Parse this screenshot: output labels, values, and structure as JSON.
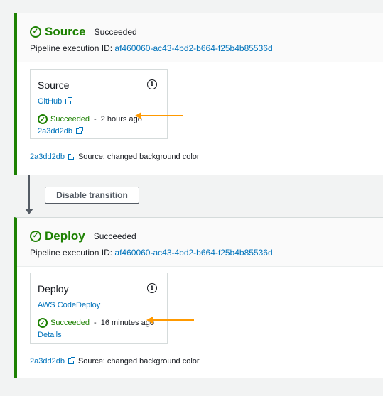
{
  "stages": [
    {
      "name": "Source",
      "status": "Succeeded",
      "execution_label": "Pipeline execution ID:",
      "execution_id": "af460060-ac43-4bd2-b664-f25b4b85536d",
      "action": {
        "title": "Source",
        "provider": "GitHub",
        "status": "Succeeded",
        "separator": "-",
        "time": "2 hours ago",
        "link": "2a3dd2db"
      },
      "commit": {
        "id": "2a3dd2db",
        "message": "Source: changed background color"
      }
    },
    {
      "name": "Deploy",
      "status": "Succeeded",
      "execution_label": "Pipeline execution ID:",
      "execution_id": "af460060-ac43-4bd2-b664-f25b4b85536d",
      "action": {
        "title": "Deploy",
        "provider": "AWS CodeDeploy",
        "status": "Succeeded",
        "separator": "-",
        "time": "16 minutes ago",
        "link": "Details"
      },
      "commit": {
        "id": "2a3dd2db",
        "message": "Source: changed background color"
      }
    }
  ],
  "transition": {
    "button_label": "Disable transition"
  },
  "icons": {
    "success": "check-circle-icon",
    "info": "info-icon",
    "external": "external-link-icon"
  },
  "colors": {
    "success": "#1d8102",
    "link": "#0073bb",
    "annotation_arrow": "#ff9900"
  }
}
